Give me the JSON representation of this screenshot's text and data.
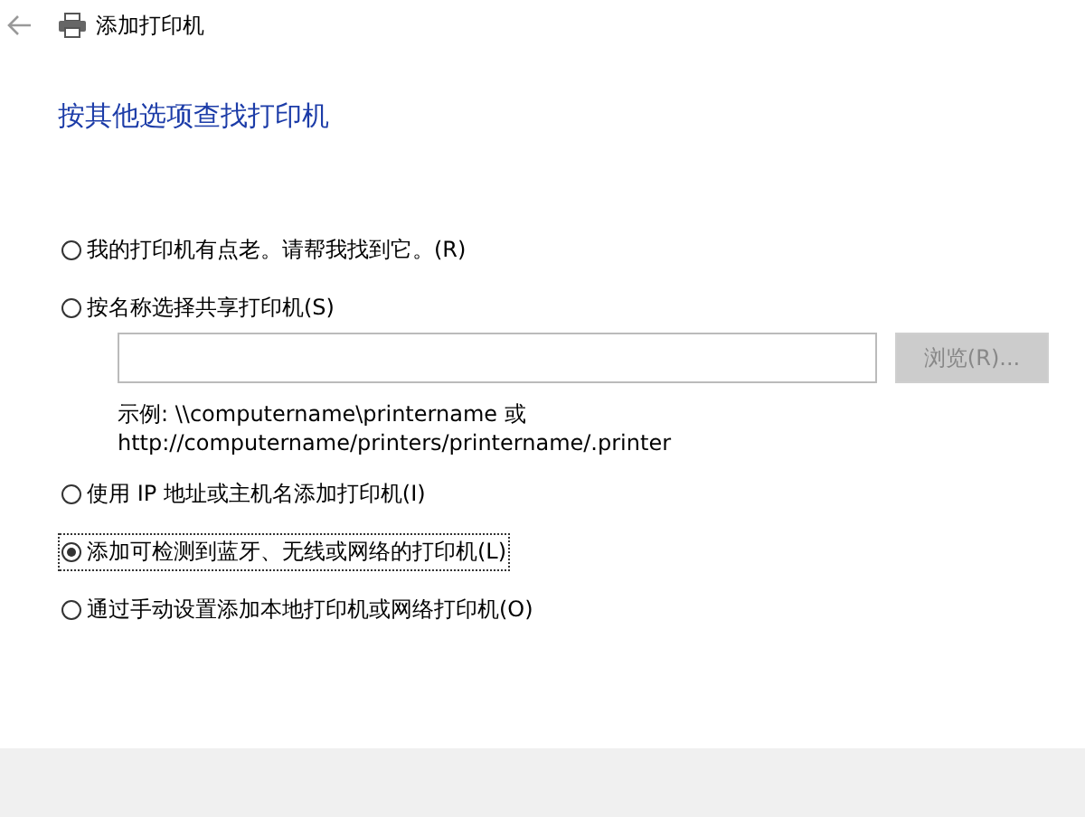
{
  "window": {
    "title": "添加打印机"
  },
  "heading": "按其他选项查找打印机",
  "options": [
    {
      "label": "我的打印机有点老。请帮我找到它。(R)",
      "selected": false
    },
    {
      "label": "按名称选择共享打印机(S)",
      "selected": false,
      "kind": "share"
    },
    {
      "label": "使用 IP 地址或主机名添加打印机(I)",
      "selected": false
    },
    {
      "label": "添加可检测到蓝牙、无线或网络的打印机(L)",
      "selected": true
    },
    {
      "label": "通过手动设置添加本地打印机或网络打印机(O)",
      "selected": false
    }
  ],
  "share_path": {
    "browse_button": {
      "label": "浏览(R)...",
      "disabled": true
    },
    "example": [
      "示例: \\\\computername\\printername 或",
      "http://computername/printers/printername/.printer"
    ]
  }
}
